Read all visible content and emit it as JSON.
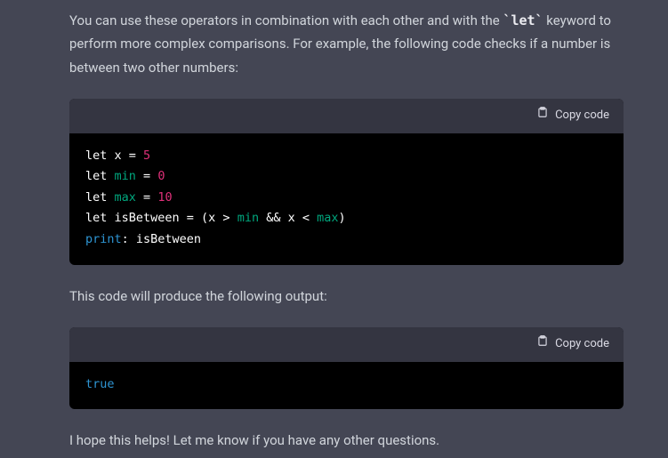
{
  "intro": {
    "part1": "You can use these operators in combination with each other and with the ",
    "code": "`let`",
    "part2": " keyword to perform more complex comparisons. For example, the following code checks if a number is between two other numbers:"
  },
  "copy_label": "Copy code",
  "block1": {
    "l1": {
      "a": "let",
      "b": " x = ",
      "c": "5"
    },
    "l2": {
      "a": "let",
      "b": " ",
      "c": "min",
      "d": " = ",
      "e": "0"
    },
    "l3": {
      "a": "let",
      "b": " ",
      "c": "max",
      "d": " = ",
      "e": "10"
    },
    "l4": {
      "a": "let",
      "b": " isBetween = (x > ",
      "c": "min",
      "d": " && x < ",
      "e": "max",
      "f": ")"
    },
    "l5": {
      "a": "print",
      "b": ": isBetween"
    }
  },
  "mid_text": "This code will produce the following output:",
  "block2": {
    "l1": "true"
  },
  "outro": "I hope this helps! Let me know if you have any other questions.",
  "chart_data": null
}
